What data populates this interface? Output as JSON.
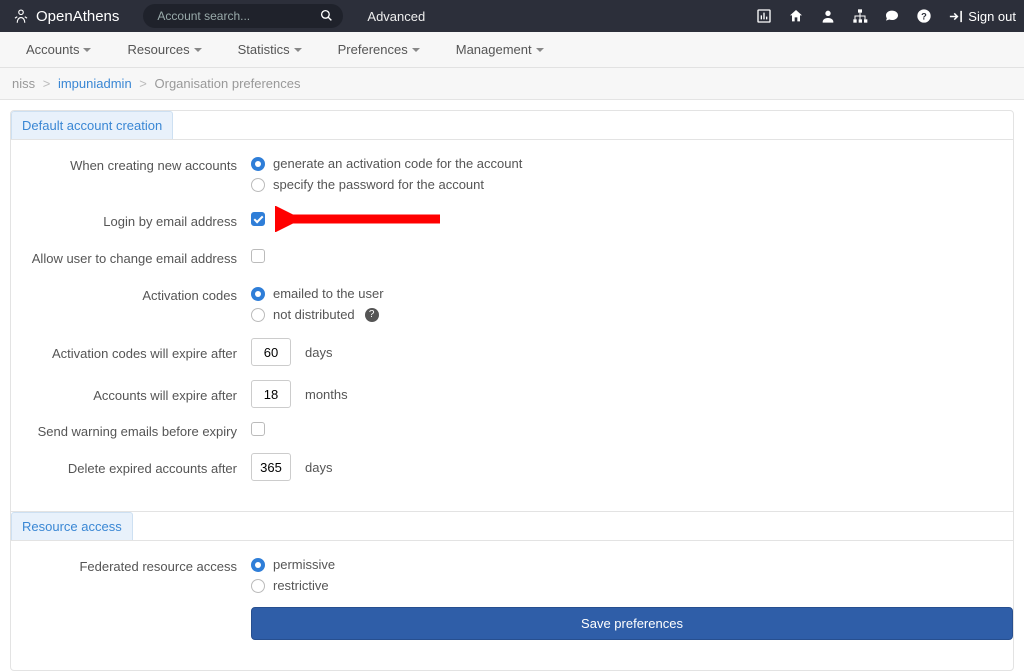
{
  "top": {
    "brand_thin": "Open",
    "brand_bold": "Athens",
    "search_placeholder": "Account search...",
    "advanced": "Advanced",
    "sign_out": "Sign out"
  },
  "nav": {
    "accounts": "Accounts",
    "resources": "Resources",
    "statistics": "Statistics",
    "preferences": "Preferences",
    "management": "Management"
  },
  "breadcrumb": {
    "c0": "niss",
    "c1": "impuniadmin",
    "c2": "Organisation preferences"
  },
  "sections": {
    "default_creation": "Default account creation",
    "resource_access": "Resource access"
  },
  "labels": {
    "when_creating": "When creating new accounts",
    "login_email": "Login by email address",
    "allow_change_email": "Allow user to change email address",
    "activation_codes": "Activation codes",
    "codes_expire": "Activation codes will expire after",
    "accounts_expire": "Accounts will expire after",
    "warning_emails": "Send warning emails before expiry",
    "delete_expired": "Delete expired accounts after",
    "federated": "Federated resource access"
  },
  "options": {
    "gen_activation": "generate an activation code for the account",
    "specify_password": "specify the password for the account",
    "emailed_user": "emailed to the user",
    "not_distributed": "not distributed",
    "permissive": "permissive",
    "restrictive": "restrictive"
  },
  "values": {
    "codes_expire_days": "60",
    "accounts_expire_months": "18",
    "delete_after_days": "365"
  },
  "units": {
    "days": "days",
    "months": "months"
  },
  "buttons": {
    "save": "Save preferences"
  }
}
